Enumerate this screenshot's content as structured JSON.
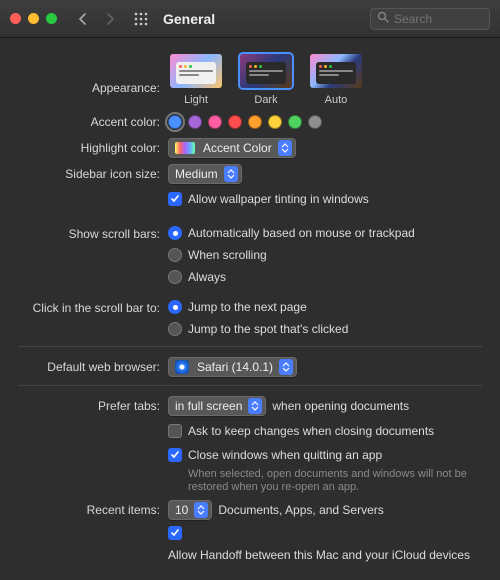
{
  "titlebar": {
    "title": "General",
    "search_placeholder": "Search"
  },
  "appearance": {
    "label": "Appearance:",
    "options": {
      "light": "Light",
      "dark": "Dark",
      "auto": "Auto"
    },
    "selected": "dark"
  },
  "accent": {
    "label": "Accent color:",
    "colors": [
      "#4a90ff",
      "#a667d8",
      "#ff5fa2",
      "#ff4d4d",
      "#ff9f2e",
      "#ffd23a",
      "#4fd25f",
      "#8e8e8e"
    ],
    "selected_index": 0
  },
  "highlight": {
    "label": "Highlight color:",
    "value": "Accent Color"
  },
  "sidebar_size": {
    "label": "Sidebar icon size:",
    "value": "Medium"
  },
  "wallpaper_tint": {
    "label": "Allow wallpaper tinting in windows",
    "checked": true
  },
  "scrollbars": {
    "label": "Show scroll bars:",
    "options": {
      "auto": "Automatically based on mouse or trackpad",
      "scrolling": "When scrolling",
      "always": "Always"
    },
    "selected": "auto"
  },
  "click_scrollbar": {
    "label": "Click in the scroll bar to:",
    "options": {
      "next": "Jump to the next page",
      "spot": "Jump to the spot that's clicked"
    },
    "selected": "next"
  },
  "browser": {
    "label": "Default web browser:",
    "value": "Safari (14.0.1)"
  },
  "tabs": {
    "label": "Prefer tabs:",
    "value": "in full screen",
    "suffix": "when opening documents"
  },
  "ask_changes": {
    "label": "Ask to keep changes when closing documents",
    "checked": false
  },
  "close_windows": {
    "label": "Close windows when quitting an app",
    "checked": true,
    "sub": "When selected, open documents and windows will not be restored when you re-open an app."
  },
  "recent": {
    "label": "Recent items:",
    "value": "10",
    "suffix": "Documents, Apps, and Servers"
  },
  "handoff": {
    "label": "Allow Handoff between this Mac and your iCloud devices",
    "checked": true
  }
}
